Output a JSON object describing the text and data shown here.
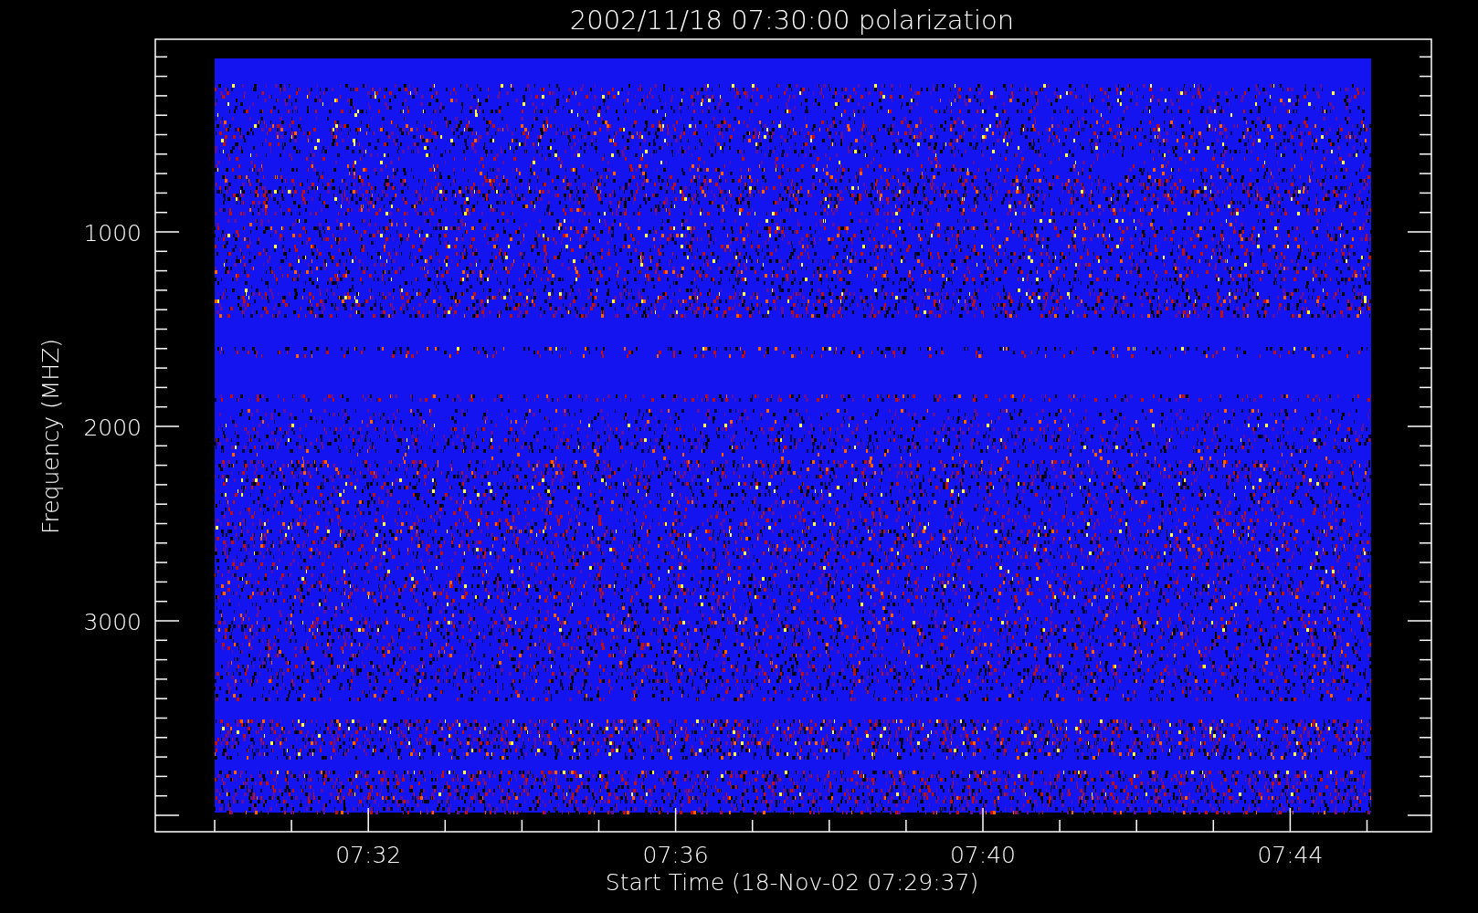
{
  "title": "2002/11/18 07:30:00 polarization",
  "y_axis": {
    "label": "Frequency (MHZ)",
    "ticks": [
      "1000",
      "2000",
      "3000"
    ]
  },
  "x_axis": {
    "label": "Start Time (18-Nov-02 07:29:37)",
    "ticks": [
      "07:32",
      "07:36",
      "07:40",
      "07:44"
    ]
  }
}
